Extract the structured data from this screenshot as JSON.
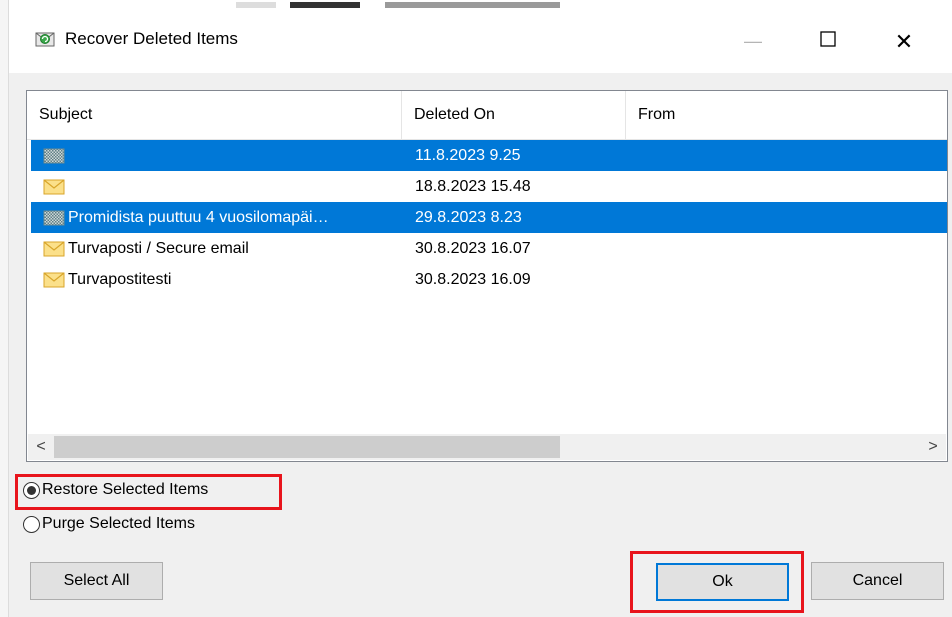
{
  "window": {
    "title": "Recover Deleted Items",
    "minimize_glyph": "—",
    "maximize_glyph": "☐",
    "close_glyph": "✕"
  },
  "columns": {
    "subject": "Subject",
    "deleted_on": "Deleted On",
    "from": "From"
  },
  "rows": [
    {
      "icon": "encrypted-mail-icon",
      "subject": "",
      "deleted_on": "11.8.2023 9.25",
      "from": "",
      "selected": true
    },
    {
      "icon": "envelope-icon",
      "subject": "",
      "deleted_on": "18.8.2023 15.48",
      "from": "",
      "selected": false
    },
    {
      "icon": "encrypted-mail-icon",
      "subject": "Promidista puuttuu 4 vuosilomapäi…",
      "deleted_on": "29.8.2023 8.23",
      "from": "",
      "selected": true
    },
    {
      "icon": "envelope-icon",
      "subject": "Turvaposti / Secure email",
      "deleted_on": "30.8.2023 16.07",
      "from": "",
      "selected": false
    },
    {
      "icon": "envelope-icon",
      "subject": "Turvapostitesti",
      "deleted_on": "30.8.2023 16.09",
      "from": "",
      "selected": false
    }
  ],
  "scrollbar": {
    "left_arrow": "<",
    "right_arrow": ">"
  },
  "options": {
    "restore_label": "Restore Selected Items",
    "purge_label": "Purge Selected Items",
    "selected": "restore"
  },
  "buttons": {
    "select_all": "Select All",
    "ok": "Ok",
    "cancel": "Cancel"
  },
  "colors": {
    "selection": "#0078d7",
    "highlight_box": "#e8141c",
    "envelope": "#f5c542"
  }
}
